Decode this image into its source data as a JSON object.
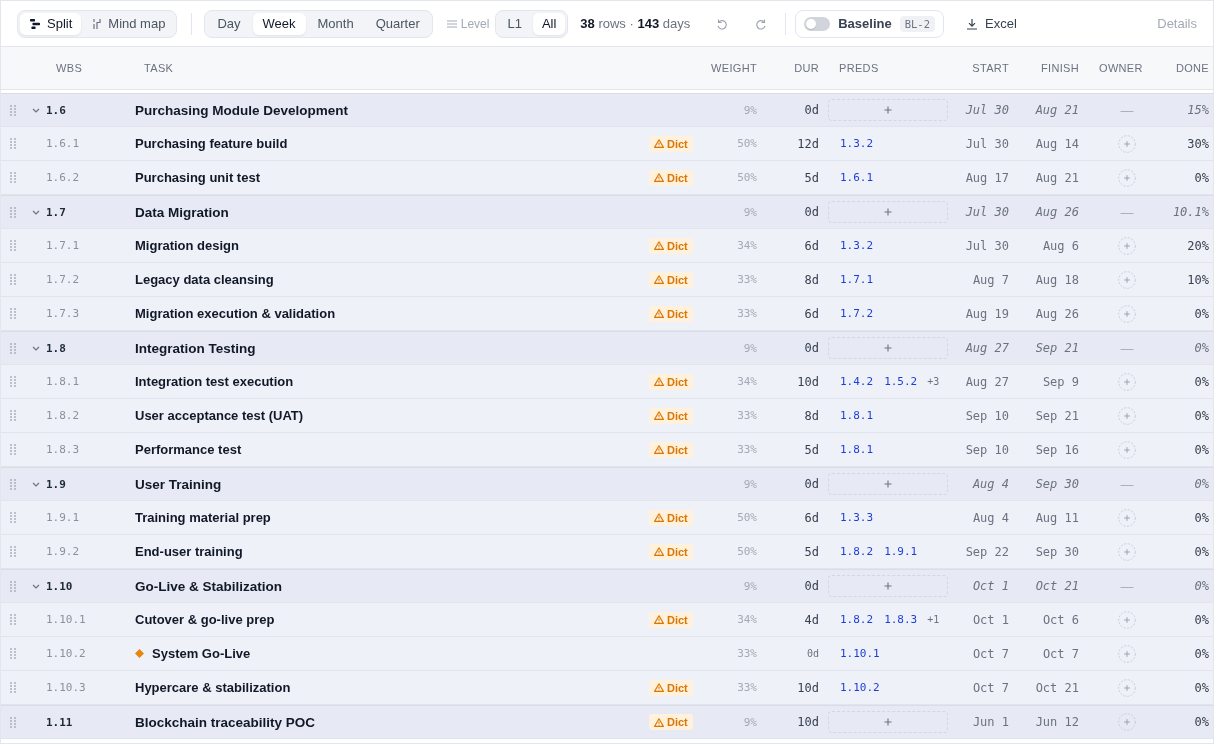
{
  "toolbar": {
    "view_modes": [
      {
        "label": "Split",
        "selected": true
      },
      {
        "label": "Mind map",
        "selected": false
      }
    ],
    "scales": [
      {
        "label": "Day",
        "selected": false
      },
      {
        "label": "Week",
        "selected": true
      },
      {
        "label": "Month",
        "selected": false
      },
      {
        "label": "Quarter",
        "selected": false
      }
    ],
    "level_label": "Level",
    "levels": [
      {
        "label": "L1",
        "selected": false
      },
      {
        "label": "All",
        "selected": true
      }
    ],
    "summary": "**38** rows · **143** days",
    "baseline": {
      "label": "Baseline",
      "on": false,
      "tag": "BL-2"
    },
    "export": {
      "label": "Excel"
    },
    "details": {
      "label": "Details",
      "disabled": true
    }
  },
  "table": {
    "columns": [
      "WBS",
      "TASK",
      "WEIGHT",
      "DUR",
      "PREDS",
      "START",
      "FINISH",
      "OWNER",
      "DONE"
    ],
    "rows": [
      {
        "wbs": "1.6",
        "task": "Purchasing Module Development",
        "kind": "summary",
        "expanded": true,
        "weight": "9%",
        "dur": "0d",
        "start": "Jul 30",
        "finish": "Aug 21",
        "owner": "—",
        "done": "15%",
        "children": [
          {
            "wbs": "1.6.1",
            "task": "Purchasing feature build",
            "kind": "task",
            "badge": "Dict",
            "weight": "50%",
            "dur": "12d",
            "preds": [
              "1.3.2"
            ],
            "start": "Jul 30",
            "finish": "Aug 14",
            "done": "30%"
          },
          {
            "wbs": "1.6.2",
            "task": "Purchasing unit test",
            "kind": "task",
            "badge": "Dict",
            "weight": "50%",
            "dur": "5d",
            "preds": [
              "1.6.1"
            ],
            "start": "Aug 17",
            "finish": "Aug 21",
            "done": "0%"
          }
        ]
      },
      {
        "wbs": "1.7",
        "task": "Data Migration",
        "kind": "summary",
        "expanded": true,
        "weight": "9%",
        "dur": "0d",
        "start": "Jul 30",
        "finish": "Aug 26",
        "owner": "—",
        "done": "10.1%",
        "children": [
          {
            "wbs": "1.7.1",
            "task": "Migration design",
            "kind": "task",
            "badge": "Dict",
            "weight": "34%",
            "dur": "6d",
            "preds": [
              "1.3.2"
            ],
            "start": "Jul 30",
            "finish": "Aug 6",
            "done": "20%"
          },
          {
            "wbs": "1.7.2",
            "task": "Legacy data cleansing",
            "kind": "task",
            "badge": "Dict",
            "weight": "33%",
            "dur": "8d",
            "preds": [
              "1.7.1"
            ],
            "start": "Aug 7",
            "finish": "Aug 18",
            "done": "10%"
          },
          {
            "wbs": "1.7.3",
            "task": "Migration execution & validation",
            "kind": "task",
            "badge": "Dict",
            "weight": "33%",
            "dur": "6d",
            "preds": [
              "1.7.2"
            ],
            "start": "Aug 19",
            "finish": "Aug 26",
            "done": "0%"
          }
        ]
      },
      {
        "wbs": "1.8",
        "task": "Integration Testing",
        "kind": "summary",
        "expanded": true,
        "weight": "9%",
        "dur": "0d",
        "start": "Aug 27",
        "finish": "Sep 21",
        "owner": "—",
        "done": "0%",
        "children": [
          {
            "wbs": "1.8.1",
            "task": "Integration test execution",
            "kind": "task",
            "badge": "Dict",
            "weight": "34%",
            "dur": "10d",
            "preds": [
              "1.4.2",
              "1.5.2"
            ],
            "more_preds": "+3",
            "start": "Aug 27",
            "finish": "Sep 9",
            "done": "0%"
          },
          {
            "wbs": "1.8.2",
            "task": "User acceptance test (UAT)",
            "kind": "task",
            "badge": "Dict",
            "weight": "33%",
            "dur": "8d",
            "preds": [
              "1.8.1"
            ],
            "start": "Sep 10",
            "finish": "Sep 21",
            "done": "0%"
          },
          {
            "wbs": "1.8.3",
            "task": "Performance test",
            "kind": "task",
            "badge": "Dict",
            "weight": "33%",
            "dur": "5d",
            "preds": [
              "1.8.1"
            ],
            "start": "Sep 10",
            "finish": "Sep 16",
            "done": "0%"
          }
        ]
      },
      {
        "wbs": "1.9",
        "task": "User Training",
        "kind": "summary",
        "expanded": true,
        "weight": "9%",
        "dur": "0d",
        "start": "Aug 4",
        "finish": "Sep 30",
        "owner": "—",
        "done": "0%",
        "children": [
          {
            "wbs": "1.9.1",
            "task": "Training material prep",
            "kind": "task",
            "badge": "Dict",
            "weight": "50%",
            "dur": "6d",
            "preds": [
              "1.3.3"
            ],
            "start": "Aug 4",
            "finish": "Aug 11",
            "done": "0%"
          },
          {
            "wbs": "1.9.2",
            "task": "End-user training",
            "kind": "task",
            "badge": "Dict",
            "weight": "50%",
            "dur": "5d",
            "preds": [
              "1.8.2",
              "1.9.1"
            ],
            "start": "Sep 22",
            "finish": "Sep 30",
            "done": "0%"
          }
        ]
      },
      {
        "wbs": "1.10",
        "task": "Go-Live & Stabilization",
        "kind": "summary",
        "expanded": true,
        "weight": "9%",
        "dur": "0d",
        "start": "Oct 1",
        "finish": "Oct 21",
        "owner": "—",
        "done": "0%",
        "children": [
          {
            "wbs": "1.10.1",
            "task": "Cutover & go-live prep",
            "kind": "task",
            "badge": "Dict",
            "weight": "34%",
            "dur": "4d",
            "preds": [
              "1.8.2",
              "1.8.3"
            ],
            "more_preds": "+1",
            "start": "Oct 1",
            "finish": "Oct 6",
            "done": "0%"
          },
          {
            "wbs": "1.10.2",
            "task": "System Go-Live",
            "kind": "milestone",
            "weight": "33%",
            "dur": "0d",
            "preds": [
              "1.10.1"
            ],
            "start": "Oct 7",
            "finish": "Oct 7",
            "done": "0%"
          },
          {
            "wbs": "1.10.3",
            "task": "Hypercare & stabilization",
            "kind": "task",
            "badge": "Dict",
            "weight": "33%",
            "dur": "10d",
            "preds": [
              "1.10.2"
            ],
            "start": "Oct 7",
            "finish": "Oct 21",
            "done": "0%"
          }
        ]
      },
      {
        "wbs": "1.11",
        "task": "Blockchain traceability POC",
        "kind": "task",
        "badge": "Dict",
        "weight": "9%",
        "dur": "10d",
        "start": "Jun 1",
        "finish": "Jun 12",
        "done": "0%"
      }
    ]
  }
}
